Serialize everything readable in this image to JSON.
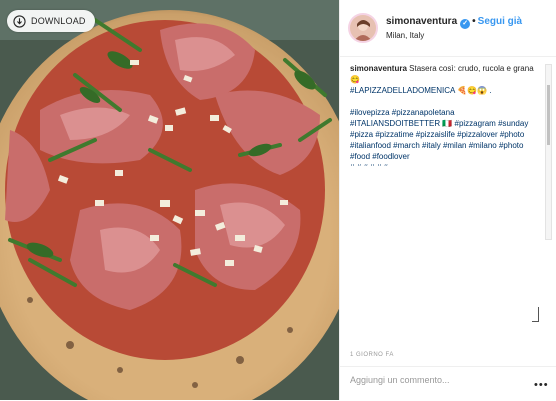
{
  "photo": {
    "alt": "pizza-photo",
    "download_label": "DOWNLOAD",
    "download_icon": "download-icon"
  },
  "post": {
    "username": "simonaventura",
    "verified_icon": "verified-badge-icon",
    "separator": "•",
    "follow_label": "Segui già",
    "location": "Milan, Italy"
  },
  "caption": {
    "username": "simonaventura",
    "text": "Stasera così: crudo, rucola e grana 😋",
    "hashtags_line1": "#LAPIZZADELLADOMENICA 🍕😋😱 .",
    "hashtags": "#ilovepizza #pizzanapoletana #ITALIANSDOITBETTER 🇮🇹 #pizzagram #sunday #pizza #pizzatime #pizzaislife #pizzalover #photo #italianfood #march #italy #milan #milano #photo #food #foodlover",
    "cut_line": "# # # # # #"
  },
  "timestamp": "1 GIORNO FA",
  "comment": {
    "placeholder": "Aggiungi un commento...",
    "more_icon": "more-options-icon",
    "more_glyph": "•••"
  },
  "colors": {
    "link": "#003569",
    "follow": "#3897f0",
    "text": "#262626",
    "muted": "#999999"
  }
}
